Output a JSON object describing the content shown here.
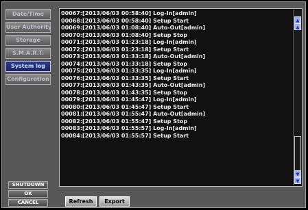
{
  "sidebar": {
    "items": [
      {
        "label": "Date/Time",
        "active": false
      },
      {
        "label": "User Authority",
        "active": false
      },
      {
        "label": "Storage",
        "active": false
      },
      {
        "label": "S.M.A.R.T.",
        "active": false
      },
      {
        "label": "System log",
        "active": true
      },
      {
        "label": "Configuration",
        "active": false
      }
    ],
    "shutdown_label": "SHUTDOWN",
    "ok_label": "OK",
    "cancel_label": "CANCEL"
  },
  "log": {
    "entries": [
      "00067:[2013/06/03 00:58:40] Log-In[admin]",
      "00068:[2013/06/03 00:58:40] Setup Start",
      "00069:[2013/06/03 01:08:40] Auto-Out[admin]",
      "00070:[2013/06/03 01:08:40] Setup Stop",
      "00071:[2013/06/03 01:23:18] Log-In[admin]",
      "00072:[2013/06/03 01:23:18] Setup Start",
      "00073:[2013/06/03 01:33:18] Auto-Out[admin]",
      "00074:[2013/06/03 01:33:18] Setup Stop",
      "00075:[2013/06/03 01:33:35] Log-In[admin]",
      "00076:[2013/06/03 01:33:35] Setup Start",
      "00077:[2013/06/03 01:43:35] Auto-Out[admin]",
      "00078:[2013/06/03 01:43:35] Setup Stop",
      "00079:[2013/06/03 01:45:47] Log-In[admin]",
      "00080:[2013/06/03 01:45:47] Setup Start",
      "00081:[2013/06/03 01:55:47] Auto-Out[admin]",
      "00082:[2013/06/03 01:55:47] Setup Stop",
      "00083:[2013/06/03 01:55:57] Log-In[admin]",
      "00084:[2013/06/03 01:55:57] Setup Start"
    ],
    "scroll_up_icon": "arrow-up",
    "scroll_down_icon": "arrow-down"
  },
  "actions": {
    "refresh_label": "Refresh",
    "export_label": "Export"
  },
  "colors": {
    "active_item": "#1a2462",
    "panel_bg": "#585858",
    "log_bg": "#111111"
  }
}
